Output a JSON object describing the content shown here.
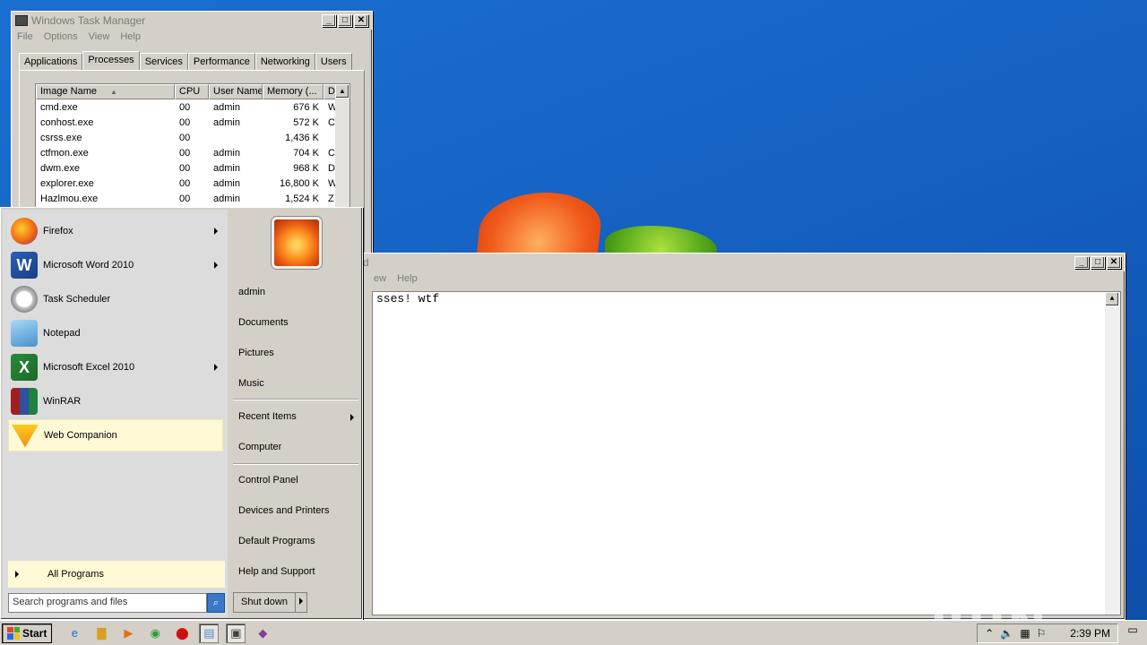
{
  "taskmgr": {
    "title": "Windows Task Manager",
    "menu": [
      "File",
      "Options",
      "View",
      "Help"
    ],
    "tabs": [
      "Applications",
      "Processes",
      "Services",
      "Performance",
      "Networking",
      "Users"
    ],
    "active_tab": "Processes",
    "columns": [
      "Image Name",
      "CPU",
      "User Name",
      "Memory (...",
      "D"
    ],
    "rows": [
      {
        "name": "cmd.exe",
        "cpu": "00",
        "user": "admin",
        "mem": "676 K",
        "desc": "W"
      },
      {
        "name": "conhost.exe",
        "cpu": "00",
        "user": "admin",
        "mem": "572 K",
        "desc": "C"
      },
      {
        "name": "csrss.exe",
        "cpu": "00",
        "user": "",
        "mem": "1,436 K",
        "desc": ""
      },
      {
        "name": "ctfmon.exe",
        "cpu": "00",
        "user": "admin",
        "mem": "704 K",
        "desc": "C"
      },
      {
        "name": "dwm.exe",
        "cpu": "00",
        "user": "admin",
        "mem": "968 K",
        "desc": "D"
      },
      {
        "name": "explorer.exe",
        "cpu": "00",
        "user": "admin",
        "mem": "16,800 K",
        "desc": "W"
      },
      {
        "name": "Hazlmou.exe",
        "cpu": "00",
        "user": "admin",
        "mem": "1,524 K",
        "desc": "Z"
      }
    ]
  },
  "notepad": {
    "title": "d",
    "menu": [
      "ew",
      "Help"
    ],
    "content": "sses! wtf"
  },
  "startmenu": {
    "programs": [
      {
        "label": "Firefox",
        "icon": "firefox-icon",
        "has_arrow": true
      },
      {
        "label": "Microsoft Word 2010",
        "icon": "word-icon",
        "has_arrow": true
      },
      {
        "label": "Task Scheduler",
        "icon": "task-scheduler-icon",
        "has_arrow": false
      },
      {
        "label": "Notepad",
        "icon": "notepad-icon",
        "has_arrow": false
      },
      {
        "label": "Microsoft Excel 2010",
        "icon": "excel-icon",
        "has_arrow": true
      },
      {
        "label": "WinRAR",
        "icon": "winrar-icon",
        "has_arrow": false
      },
      {
        "label": "Web Companion",
        "icon": "web-companion-icon",
        "has_arrow": false
      }
    ],
    "all_programs": "All Programs",
    "search_placeholder": "Search programs and files",
    "right": [
      "admin",
      "Documents",
      "Pictures",
      "Music",
      "Recent Items",
      "Computer",
      "Control Panel",
      "Devices and Printers",
      "Default Programs",
      "Help and Support"
    ],
    "shutdown": "Shut down"
  },
  "taskbar": {
    "start": "Start",
    "clock": "2:39 PM"
  },
  "watermark": "ANY RUN"
}
